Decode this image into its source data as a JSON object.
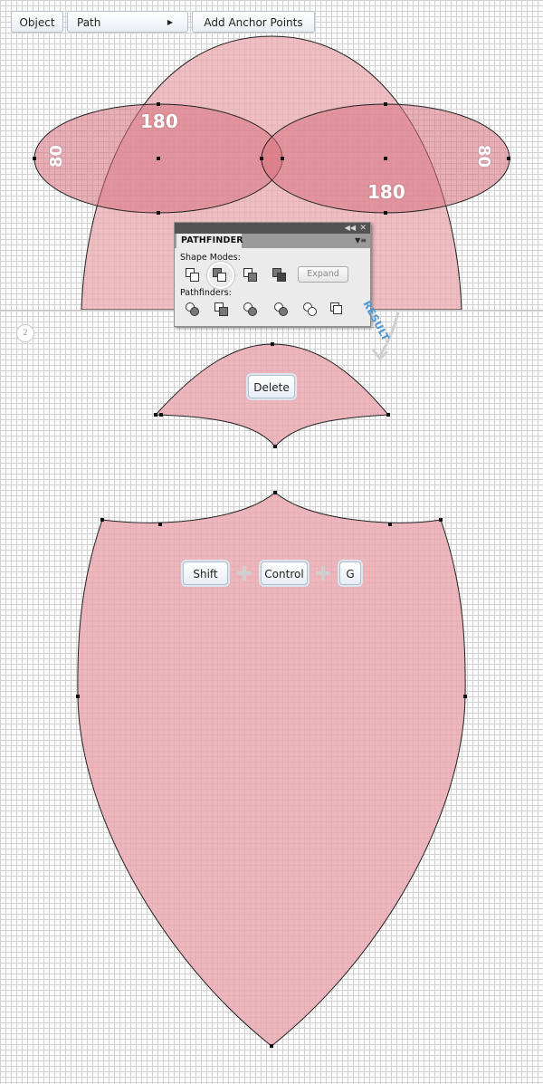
{
  "menu": {
    "object_label": "Object",
    "path_label": "Path",
    "add_anchor_label": "Add Anchor Points"
  },
  "dimensions": {
    "width_left": "180",
    "width_right": "180",
    "height_left": "80",
    "height_right": "80"
  },
  "pathfinder": {
    "title": "PATHFINDER",
    "shape_modes_label": "Shape Modes:",
    "pathfinders_label": "Pathfinders:",
    "expand_label": "Expand"
  },
  "result_label": "RESULT",
  "step_number": "2",
  "delete_key": "Delete",
  "shortcut": {
    "shift": "Shift",
    "control": "Control",
    "g": "G"
  },
  "colors": {
    "shape_fill": "#e9a9b0",
    "overlap_fill": "#d56d7d",
    "result_accent": "#4a98d6"
  }
}
